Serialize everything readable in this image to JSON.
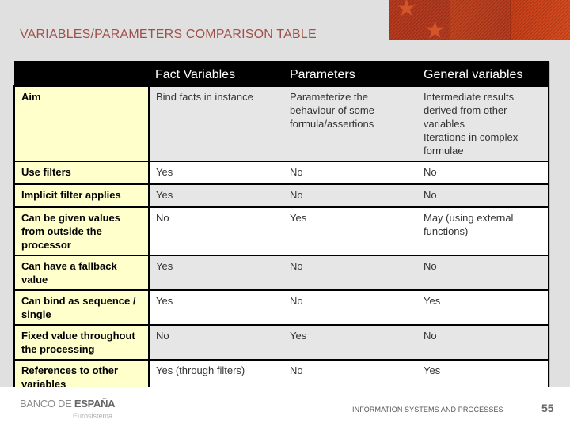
{
  "slide": {
    "title": "VARIABLES/PARAMETERS COMPARISON TABLE"
  },
  "banner": {
    "icons": [
      "star-icon",
      "star-icon"
    ]
  },
  "table": {
    "headers": [
      "",
      "Fact Variables",
      "Parameters",
      "General variables"
    ],
    "rows": [
      {
        "label": "Aim",
        "fact": "Bind facts in instance",
        "param": "Parameterize the behaviour of some formula/assertions",
        "general": "Intermediate results derived from other variables\nIterations in complex formulae"
      },
      {
        "label": "Use filters",
        "fact": "Yes",
        "param": "No",
        "general": "No"
      },
      {
        "label": "Implicit filter applies",
        "fact": "Yes",
        "param": "No",
        "general": "No"
      },
      {
        "label": "Can be given values from outside the processor",
        "fact": "No",
        "param": "Yes",
        "general": "May (using external functions)"
      },
      {
        "label": "Can have a fallback value",
        "fact": "Yes",
        "param": "No",
        "general": "No"
      },
      {
        "label": "Can bind as sequence / single",
        "fact": "Yes",
        "param": "No",
        "general": "Yes"
      },
      {
        "label": "Fixed value throughout the processing",
        "fact": "No",
        "param": "Yes",
        "general": "No"
      },
      {
        "label": "References to other variables",
        "fact": "Yes (through filters)",
        "param": "No",
        "general": "Yes"
      }
    ]
  },
  "footer": {
    "logo_light": "BANCO DE ",
    "logo_bold": "ESPAÑA",
    "logo_sub": "Eurosistema",
    "section": "INFORMATION SYSTEMS AND PROCESSES",
    "page_number": "55"
  },
  "colors": {
    "title": "#a0524a",
    "header_bg": "#000000",
    "rowhead_bg": "#ffffcc",
    "row_gray": "#e6e6e6",
    "row_white": "#ffffff",
    "banner": "#b83a1e"
  }
}
